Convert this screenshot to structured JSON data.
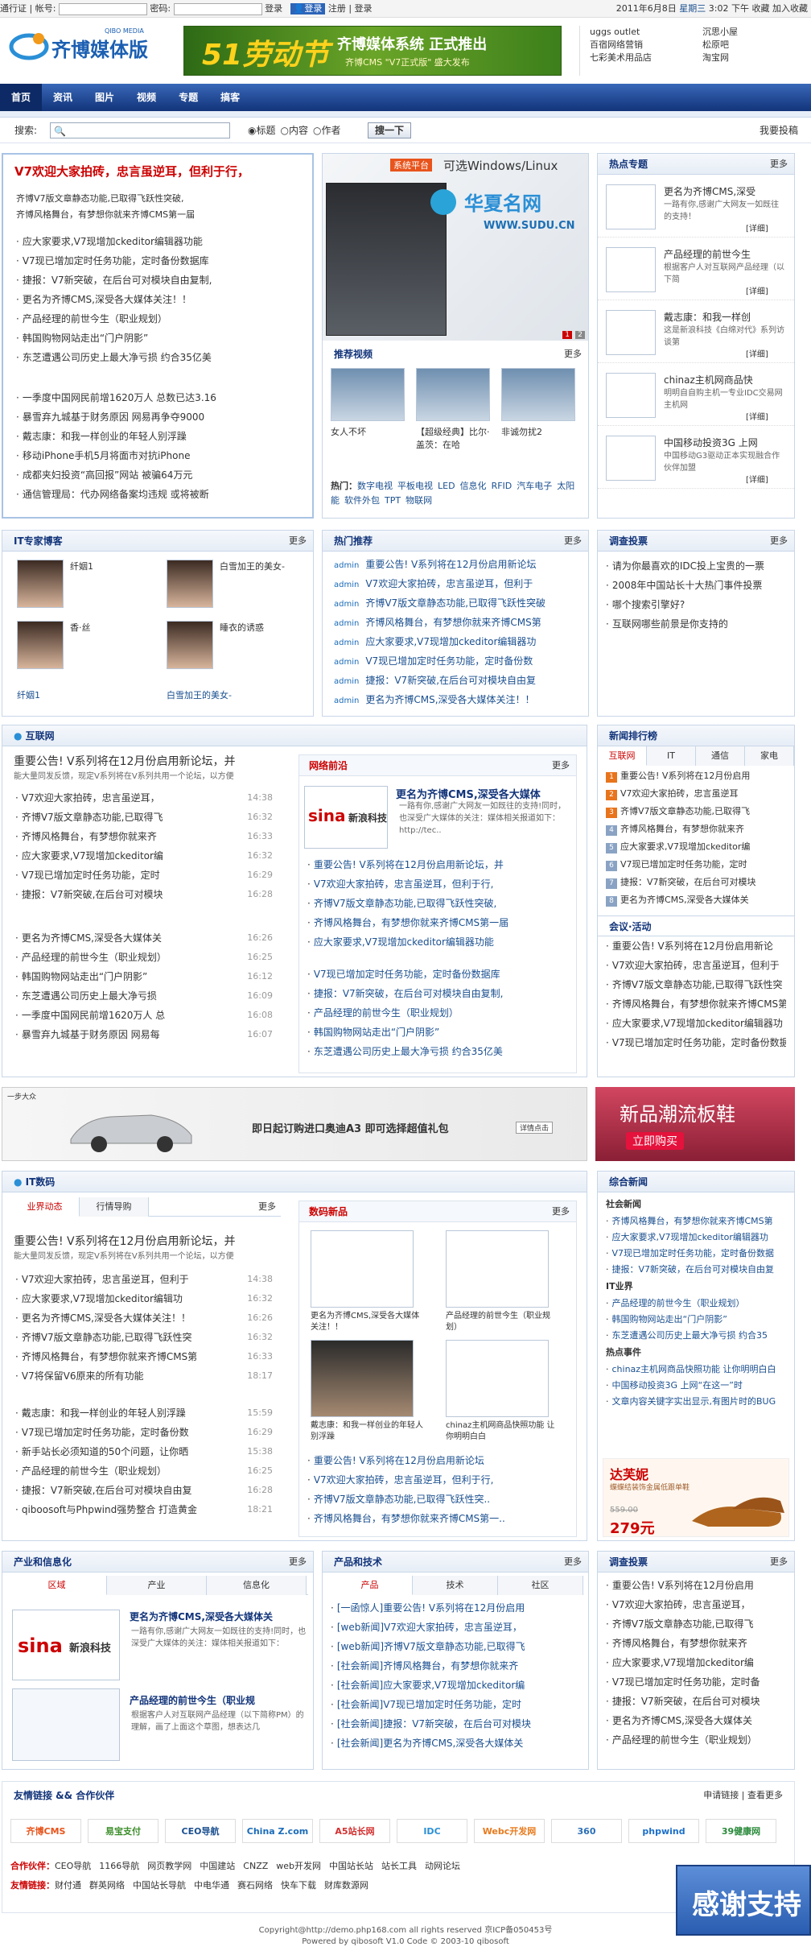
{
  "topbar": {
    "left": "通行证 | 帐号:",
    "pwd": "密码:",
    "login": "登录",
    "login_btn": "登录",
    "register": "注册",
    "logout": "登录",
    "date": "2011年6月8日",
    "weekday": "星期三",
    "time": "3:02 下午",
    "fav": "收藏",
    "add_fav": "加入收藏"
  },
  "logo": {
    "main": "齐博媒体版",
    "sub": "QIBO MEDIA"
  },
  "banner": {
    "big": "51劳动节",
    "title": "齐博媒体系统 正式推出",
    "sub": "齐博CMS \"V7正式版\" 盛大发布"
  },
  "hdr_links": [
    [
      "uggs outlet",
      "沉思小屋"
    ],
    [
      "百宿网络营销",
      "松原吧"
    ],
    [
      "七彩美术用品店",
      "淘宝网"
    ]
  ],
  "nav": [
    "首页",
    "资讯",
    "图片",
    "视频",
    "专题",
    "搞客"
  ],
  "search": {
    "label": "搜索:",
    "opts": [
      "标题",
      "内容",
      "作者"
    ],
    "btn": "搜一下",
    "right": "我要投稿"
  },
  "headline": {
    "title": "V7欢迎大家拍砖，忠言虽逆耳，但利于行，",
    "sub1": "齐博V7版文章静态功能,已取得飞跃性突破,",
    "sub2": "齐博风格舞台，有梦想你就来齐博CMS第一届"
  },
  "top_list1": [
    "应大家要求,V7现增加ckeditor编辑器功能",
    "V7现已增加定时任务功能，定时备份数据库",
    "捷报：V7新突破，在后台可对模块自由复制,",
    "更名为齐博CMS,深受各大媒体关注！！",
    "产品经理的前世今生（职业规划）",
    "韩国购物网站走出“门户阴影”",
    "东芝遭遇公司历史上最大净亏损 约合35亿美"
  ],
  "top_list2": [
    "一季度中国网民前增1620万人 总数已达3.16",
    "暴雪弃九城基于财务原因 网易再争夺9000",
    "戴志康：和我一样创业的年轻人别浮躁",
    "移动iPhone手机5月将面市对抗iPhone",
    "成都夹妇投资“高回报”网站 被骗64万元",
    "通信管理局：代办网络备案均违规 或将被断"
  ],
  "slide": {
    "tag": "系统平台",
    "slogan": "可选Windows/Linux",
    "brand": "华夏名网",
    "url": "WWW.SUDU.CN",
    "pages": [
      "1",
      "2"
    ]
  },
  "videos": {
    "title": "推荐视频",
    "more": "更多",
    "items": [
      "女人不坏",
      "【超级经典】比尔·盖茨：在哈",
      "非诚勿扰2"
    ],
    "hot_label": "热门：",
    "hot": [
      "数字电视",
      "平板电视",
      "LED",
      "信息化",
      "RFID",
      "汽车电子",
      "太阳能",
      "软件外包",
      "TPT",
      "物联网"
    ]
  },
  "topics": {
    "title": "热点专题",
    "more": "更多",
    "items": [
      {
        "t": "更名为齐博CMS,深受",
        "d": "一路有你,感谢广大网友一如既往的支持！"
      },
      {
        "t": "产品经理的前世今生",
        "d": "根据客户人对互联网产品经理（以下简",
        "e": "[详细]"
      },
      {
        "t": "戴志康：和我一样创",
        "d": "这是新浪科技《白绵对代》系列访谈第"
      },
      {
        "t": "chinaz主机网商品快",
        "d": "明明自自购主机一专业IDC交易网主机网"
      },
      {
        "t": "中国移动投资3G 上网",
        "d": "中国移动G3驱动正本实现融合作伙伴加盟"
      }
    ],
    "detail": "[详细]"
  },
  "it_experts": {
    "title": "IT专家博客",
    "more": "更多",
    "items": [
      "纤姻1",
      "白雪加王的美女-",
      "香·丝",
      "睡衣的诱惑"
    ],
    "bottom": [
      "纤姻1",
      "白雪加王的美女-"
    ]
  },
  "hot_recommend": {
    "title": "热门推荐",
    "more": "更多",
    "admin": "admin",
    "items": [
      "重要公告! V系列将在12月份启用新论坛",
      "V7欢迎大家拍砖，忠言虽逆耳，但利于",
      "齐博V7版文章静态功能,已取得飞跃性突破",
      "齐博风格舞台，有梦想你就来齐博CMS第",
      "应大家要求,V7现增加ckeditor编辑器功",
      "V7现已增加定时任务功能，定时备份数",
      "捷报：V7新突破,在后台可对模块自由复",
      "更名为齐博CMS,深受各大媒体关注！！"
    ]
  },
  "vote": {
    "title": "调查投票",
    "more": "更多",
    "items": [
      "请为你最喜欢的IDC投上宝贵的一票",
      "2008年中国站长十大热门事件投票",
      "哪个搜索引擎好?",
      "互联网哪些前景是你支持的"
    ]
  },
  "internet": {
    "title": "互联网",
    "head": "重要公告! V系列将在12月份启用新论坛，并",
    "head_sub": "能大量同发反馈，现定V系列将在V系列共用一个论坛，以方便",
    "list1": [
      [
        "V7欢迎大家拍砖，忠言虽逆耳，",
        "14:38"
      ],
      [
        "齐博V7版文章静态功能,已取得飞",
        "16:32"
      ],
      [
        "齐博风格舞台，有梦想你就来齐",
        "16:33"
      ],
      [
        "应大家要求,V7现增加ckeditor编",
        "16:32"
      ],
      [
        "V7现已增加定时任务功能，定时",
        "16:29"
      ],
      [
        "捷报：V7新突破,在后台可对模块",
        "16:28"
      ]
    ],
    "list2": [
      [
        "更名为齐博CMS,深受各大媒体关",
        "16:26"
      ],
      [
        "产品经理的前世今生（职业规划）",
        "16:25"
      ],
      [
        "韩国购物网站走出“门户阴影”",
        "16:12"
      ],
      [
        "东芝遭遇公司历史上最大净亏损",
        "16:09"
      ],
      [
        "一季度中国网民前增1620万人 总",
        "16:08"
      ],
      [
        "暴雪弃九城基于财务原因 网易每",
        "16:07"
      ]
    ]
  },
  "frontier": {
    "title": "网络前沿",
    "more": "更多",
    "head": "更名为齐博CMS,深受各大媒体",
    "desc": "一路有你,感谢广大网友一如既往的支持!同时，也深受广大媒体的关注：媒体相关报道如下：http://tec..",
    "list1": [
      "重要公告! V系列将在12月份启用新论坛，并",
      "V7欢迎大家拍砖，忠言虽逆耳，但利于行,",
      "齐博V7版文章静态功能,已取得飞跃性突破,",
      "齐博风格舞台，有梦想你就来齐博CMS第一届",
      "应大家要求,V7现增加ckeditor编辑器功能"
    ],
    "list2": [
      "V7现已增加定时任务功能，定时备份数据库",
      "捷报：V7新突破，在后台可对模块自由复制,",
      "产品经理的前世今生（职业规划）",
      "韩国购物网站走出“门户阴影”",
      "东芝遭遇公司历史上最大净亏损 约合35亿美"
    ]
  },
  "news_rank": {
    "title": "新闻排行榜",
    "tabs": [
      "互联网",
      "IT",
      "通信",
      "家电"
    ],
    "items": [
      "重要公告! V系列将在12月份启用",
      "V7欢迎大家拍砖，忠言虽逆耳",
      "齐博V7版文章静态功能,已取得飞",
      "齐博风格舞台，有梦想你就来齐",
      "应大家要求,V7现增加ckeditor编",
      "V7现已增加定时任务功能，定时",
      "捷报：V7新突破，在后台可对模块",
      "更名为齐博CMS,深受各大媒体关"
    ]
  },
  "meeting": {
    "title": "会议·活动",
    "items": [
      "重要公告! V系列将在12月份启用新论",
      "V7欢迎大家拍砖，忠言虽逆耳，但利于",
      "齐博V7版文章静态功能,已取得飞跃性突",
      "齐博风格舞台，有梦想你就来齐博CMS第",
      "应大家要求,V7现增加ckeditor编辑器功",
      "V7现已增加定时任务功能，定时备份数据"
    ]
  },
  "ad_car": {
    "small": "一步大众",
    "text": "即日起订购进口奥迪A3  即可选择超值礼包",
    "btn": "详情点击"
  },
  "ad_shoes": {
    "title": "新品潮流板鞋",
    "btn": "立即购买"
  },
  "itdigit": {
    "title": "IT数码",
    "tabs": [
      "业界动态",
      "行情导购"
    ],
    "more": "更多",
    "head": "重要公告! V系列将在12月份启用新论坛，并",
    "head_sub": "能大量同发反馈，现定V系列将在V系列共用一个论坛，以方便",
    "list1": [
      [
        "V7欢迎大家拍砖，忠言虽逆耳，但利于",
        "14:38"
      ],
      [
        "应大家要求,V7现增加ckeditor编辑功",
        "16:32"
      ],
      [
        "更名为齐博CMS,深受各大媒体关注！！",
        "16:26"
      ],
      [
        "齐博V7版文章静态功能,已取得飞跃性突",
        "16:32"
      ],
      [
        "齐博风格舞台，有梦想你就来齐博CMS第",
        "16:33"
      ],
      [
        "V7将保留V6原来的所有功能",
        "18:17"
      ]
    ],
    "list2": [
      [
        "戴志康：和我一样创业的年轻人别浮躁",
        "15:59"
      ],
      [
        "V7现已增加定时任务功能，定时备份数",
        "16:29"
      ],
      [
        "新手站长必须知道的50个问题，让你晒",
        "15:38"
      ],
      [
        "产品经理的前世今生（职业规划）",
        "16:25"
      ],
      [
        "捷报：V7新突破,在后台可对模块自由复",
        "16:28"
      ],
      [
        "qiboosoft与Phpwind强势整合 打造黄金",
        "18:21"
      ]
    ]
  },
  "digit_new": {
    "title": "数码新品",
    "more": "更多",
    "items": [
      "更名为齐博CMS,深受各大媒体关注！！",
      "产品经理的前世今生（职业规划）",
      "戴志康：和我一样创业的年轻人别浮躁",
      "chinaz主机网商品快照功能 让你明明白白"
    ],
    "list": [
      "重要公告! V系列将在12月份启用新论坛",
      "V7欢迎大家拍砖，忠言虽逆耳，但利于行,",
      "齐博V7版文章静态功能,已取得飞跃性突..",
      "齐博风格舞台，有梦想你就来齐博CMS第一.."
    ]
  },
  "composite": {
    "title": "综合新闻",
    "g1": "社会新闻",
    "l1": [
      "齐博风格舞台，有梦想你就来齐博CMS第",
      "应大家要求,V7现增加ckeditor编辑器功",
      "V7现已增加定时任务功能，定时备份数据",
      "捷报：V7新突破，在后台可对模块自由复"
    ],
    "g2": "IT业界",
    "l2": [
      "产品经理的前世今生（职业规划）",
      "韩国购物网站走出“门户阴影”",
      "东芝遭遇公司历史上最大净亏损 约合35"
    ],
    "g3": "热点事件",
    "l3": [
      "chinaz主机网商品快照功能 让你明明白白",
      "中国移动投资3G 上网“在这一”时",
      "文章内容关键字实出显示,有图片时的BUG"
    ]
  },
  "ad_heels": {
    "brand": "达芙妮",
    "sub": "蝶蝶结装饰金属低跟单鞋",
    "old": "559.00",
    "price": "279元"
  },
  "industry": {
    "title": "产业和信息化",
    "more": "更多",
    "tabs": [
      "区域",
      "产业",
      "信息化"
    ],
    "a_title": "更名为齐博CMS,深受各大媒体关",
    "a_desc": "一路有你,感谢广大网友一如既往的支持!同时，也深受广大媒体的关注：媒体相关报道如下：",
    "b_title": "产品经理的前世今生（职业规",
    "b_desc": "根据客户人对互联网产品经理（以下简称PM）的理解，画了上面这个草图，想表达几"
  },
  "products": {
    "title": "产品和技术",
    "more": "更多",
    "tabs": [
      "产品",
      "技术",
      "社区"
    ],
    "items": [
      "[一函惊人]重要公告! V系列将在12月份启用",
      "[web新闻]V7欢迎大家拍砖，忠言虽逆耳，",
      "[web新闻]齐博V7版文章静态功能,已取得飞",
      "[社会新闻]齐博风格舞台，有梦想你就来齐",
      "[社会新闻]应大家要求,V7现增加ckeditor编",
      "[社会新闻]V7现已增加定时任务功能，定时",
      "[社会新闻]捷报：V7新突破，在后台可对模块",
      "[社会新闻]更名为齐博CMS,深受各大媒体关"
    ]
  },
  "vote2": {
    "title": "调查投票",
    "more": "更多",
    "items": [
      "重要公告! V系列将在12月份启用",
      "V7欢迎大家拍砖，忠言虽逆耳，",
      "齐博V7版文章静态功能,已取得飞",
      "齐博风格舞台，有梦想你就来齐",
      "应大家要求,V7现增加ckeditor编",
      "V7现已增加定时任务功能，定时备",
      "捷报：V7新突破，在后台可对模块",
      "更名为齐博CMS,深受各大媒体关",
      "产品经理的前世今生（职业规划）"
    ]
  },
  "friends": {
    "title": "友情链接 && 合作伙伴",
    "apply": "申请链接",
    "more": "查看更多",
    "logos": [
      "齐博CMS",
      "易宝支付",
      "CEO导航",
      "China Z.com",
      "A5站长网",
      "IDC",
      "Webc开发网",
      "360",
      "phpwind",
      "39健康网"
    ],
    "partner_label": "合作伙伴：",
    "partners": [
      "CEO导航",
      "1166导航",
      "网页教学网",
      "中国建站",
      "CNZZ",
      "web开发网",
      "中国站长站",
      "站长工具",
      "动网论坛"
    ],
    "link_label": "友情链接：",
    "links": [
      "财付通",
      "群英网络",
      "中国站长导航",
      "中电华通",
      "赛石网络",
      "快车下载",
      "财库数源网"
    ]
  },
  "thanks": "感谢支持",
  "footer": {
    "l1": "Copyright@http://demo.php168.com all rights reserved 京ICP备050453号",
    "l2": "Powered by qibosoft V1.0 Code © 2003-10 qibosoft"
  },
  "colors": {
    "accent": "#12347a",
    "red": "#cc0000"
  }
}
